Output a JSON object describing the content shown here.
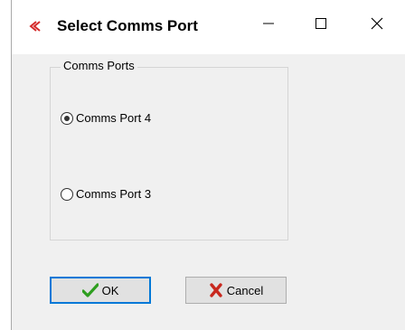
{
  "window": {
    "title": "Select Comms Port"
  },
  "titlebar": {
    "app_icon": "chevron-logo-icon",
    "minimize_icon": "minimize-icon",
    "maximize_icon": "maximize-icon",
    "close_icon": "close-icon"
  },
  "comms_ports": {
    "legend": "Comms Ports",
    "options": [
      {
        "label": "Comms Port 4",
        "selected": true
      },
      {
        "label": "Comms Port 3",
        "selected": false
      }
    ]
  },
  "buttons": {
    "ok_label": "OK",
    "ok_icon": "checkmark-icon",
    "cancel_label": "Cancel",
    "cancel_icon": "x-icon"
  },
  "colors": {
    "accent": "#0078d7",
    "ok_check": "#2e9e1f",
    "cancel_x": "#c8281e",
    "app_icon": "#d42b2b"
  }
}
